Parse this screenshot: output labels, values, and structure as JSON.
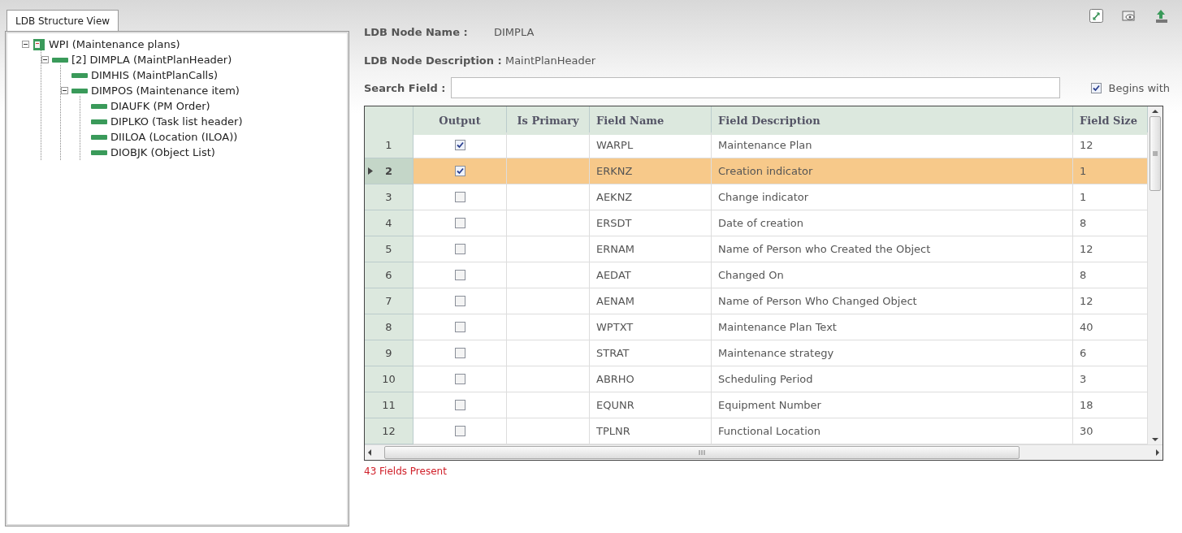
{
  "left_panel": {
    "tab": {
      "label": "LDB Structure View",
      "selected": true
    },
    "tree": [
      {
        "label": "WPI (Maintenance plans)",
        "kind": "root",
        "expanded": true,
        "children": [
          {
            "label": "[2] DIMPLA (MaintPlanHeader)",
            "kind": "node",
            "expanded": true,
            "children": [
              {
                "label": "DIMHIS (MaintPlanCalls)",
                "kind": "node"
              },
              {
                "label": "DIMPOS (Maintenance item)",
                "kind": "node",
                "expanded": true,
                "children": [
                  {
                    "label": "DIAUFK (PM Order)",
                    "kind": "node"
                  },
                  {
                    "label": "DIPLKO (Task list header)",
                    "kind": "node"
                  },
                  {
                    "label": "DIILOA (Location (ILOA))",
                    "kind": "node"
                  },
                  {
                    "label": "DIOBJK (Object List)",
                    "kind": "node"
                  }
                ]
              }
            ]
          }
        ]
      }
    ]
  },
  "node_info": {
    "name_label": "LDB Node Name :",
    "name_value": "DIMPLA",
    "description_label": "LDB Node Description :",
    "description_value": "MaintPlanHeader"
  },
  "search": {
    "label": "Search Field :",
    "begins_with": {
      "label": "Begins with",
      "checked": true
    }
  },
  "table": {
    "columns": [
      "Output",
      "Is Primary",
      "Field Name",
      "Field Description",
      "Field Size"
    ],
    "rows": [
      {
        "number": "1",
        "output": true,
        "field_name": "WARPL",
        "description": "Maintenance Plan",
        "size": "12",
        "selected": false
      },
      {
        "number": "2",
        "output": true,
        "field_name": "ERKNZ",
        "description": "Creation indicator",
        "size": "1",
        "selected": true
      },
      {
        "number": "3",
        "output": false,
        "field_name": "AEKNZ",
        "description": "Change indicator",
        "size": "1",
        "selected": false
      },
      {
        "number": "4",
        "output": false,
        "field_name": "ERSDT",
        "description": "Date of creation",
        "size": "8",
        "selected": false
      },
      {
        "number": "5",
        "output": false,
        "field_name": "ERNAM",
        "description": "Name of Person who Created the Object",
        "size": "12",
        "selected": false
      },
      {
        "number": "6",
        "output": false,
        "field_name": "AEDAT",
        "description": "Changed On",
        "size": "8",
        "selected": false
      },
      {
        "number": "7",
        "output": false,
        "field_name": "AENAM",
        "description": "Name of Person Who Changed Object",
        "size": "12",
        "selected": false
      },
      {
        "number": "8",
        "output": false,
        "field_name": "WPTXT",
        "description": "Maintenance Plan Text",
        "size": "40",
        "selected": false
      },
      {
        "number": "9",
        "output": false,
        "field_name": "STRAT",
        "description": "Maintenance strategy",
        "size": "6",
        "selected": false
      },
      {
        "number": "10",
        "output": false,
        "field_name": "ABRHO",
        "description": "Scheduling Period",
        "size": "3",
        "selected": false
      },
      {
        "number": "11",
        "output": false,
        "field_name": "EQUNR",
        "description": "Equipment Number",
        "size": "18",
        "selected": false
      },
      {
        "number": "12",
        "output": false,
        "field_name": "TPLNR",
        "description": "Functional Location",
        "size": "30",
        "selected": false
      }
    ]
  },
  "status": "43 Fields Present"
}
